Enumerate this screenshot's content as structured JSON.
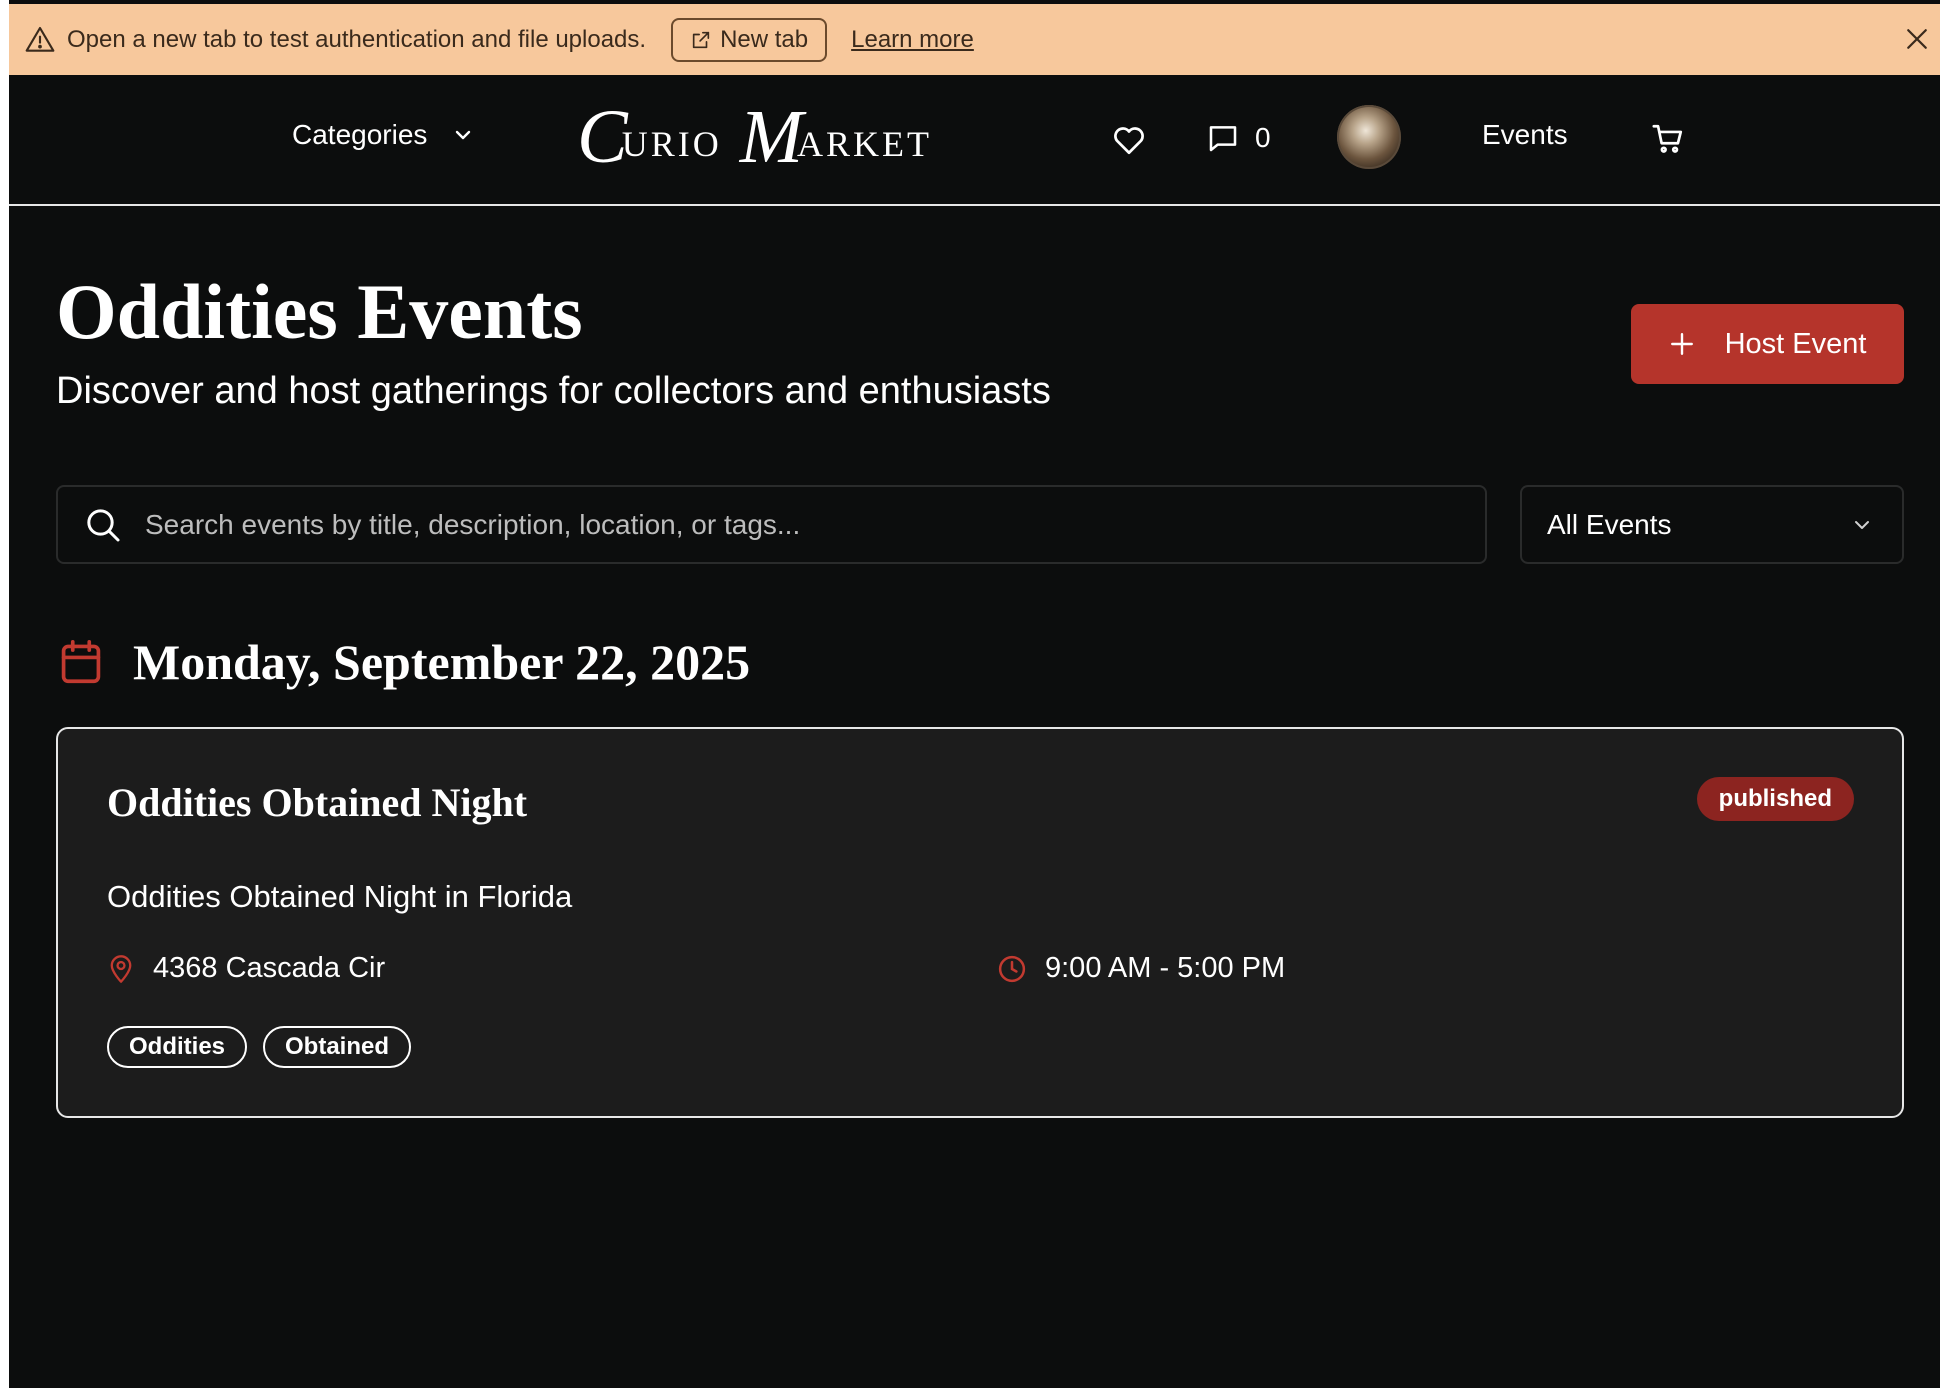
{
  "banner": {
    "message": "Open a new tab to test authentication and file uploads.",
    "new_tab_label": "New tab",
    "learn_more_label": "Learn more"
  },
  "nav": {
    "categories_label": "Categories",
    "logo": {
      "first_cap": "C",
      "first_rest": "URIO",
      "second_cap": "M",
      "second_rest": "ARKET"
    },
    "messages_count": "0",
    "events_label": "Events"
  },
  "header": {
    "title": "Oddities Events",
    "subtitle": "Discover and host gatherings for collectors and enthusiasts",
    "host_button_label": "Host Event"
  },
  "search": {
    "placeholder": "Search events by title, description, location, or tags...",
    "value": ""
  },
  "filter": {
    "selected": "All Events"
  },
  "date_heading": "Monday, September 22, 2025",
  "events": [
    {
      "title": "Oddities Obtained Night",
      "status": "published",
      "description": "Oddities Obtained Night in Florida",
      "location": "4368 Cascada Cir",
      "time": "9:00 AM - 5:00 PM",
      "tags": [
        "Oddities",
        "Obtained"
      ]
    }
  ],
  "colors": {
    "accent": "#b5342b",
    "badge": "#8c2420",
    "banner": "#f7c89c",
    "background": "#0c0d0d",
    "card": "#1c1c1c"
  },
  "icons": {
    "banner": [
      "warning-icon",
      "external-link-icon",
      "close-icon"
    ],
    "nav": [
      "chevron-down-icon",
      "heart-icon",
      "message-icon",
      "cart-icon"
    ],
    "page": [
      "plus-icon",
      "search-icon",
      "calendar-icon",
      "map-pin-icon",
      "clock-icon"
    ]
  }
}
